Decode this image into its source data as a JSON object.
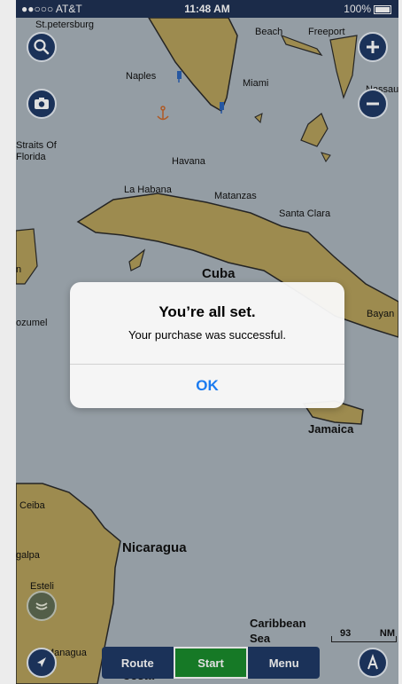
{
  "status_bar": {
    "carrier": "●●○○○ AT&T",
    "time": "11:48 AM",
    "battery": "100%"
  },
  "map": {
    "labels": {
      "st_petersburg": "St.petersburg",
      "beach": "Beach",
      "freeport": "Freeport",
      "naples": "Naples",
      "miami": "Miami",
      "nassau": "Nassau",
      "straits": "Straits Of",
      "florida": "Florida",
      "havana": "Havana",
      "la_habana": "La Habana",
      "matanzas": "Matanzas",
      "santa_clara": "Santa Clara",
      "cuba": "Cuba",
      "cozumel": "ozumel",
      "bayan": "Bayan",
      "an": "n",
      "jamaica": "Jamaica",
      "ceiba": "Ceiba",
      "nicaragua": "Nicaragua",
      "galpa": "galpa",
      "esteli": "Esteli",
      "managua": "Managua",
      "caribbean": "Caribbean",
      "sea": "Sea",
      "costa": "Costa"
    }
  },
  "scale": {
    "value": "93",
    "unit": "NM"
  },
  "alert": {
    "title": "You’re all set.",
    "message": "Your purchase was successful.",
    "ok_label": "OK"
  },
  "bottom_bar": {
    "route": "Route",
    "start": "Start",
    "menu": "Menu"
  },
  "colors": {
    "water": "#a9b3bb",
    "land": "#b39f5a",
    "button_blue": "#1f3a66",
    "start_green": "#1a8a2c",
    "ok_blue": "#1b7bf0"
  },
  "icons": {
    "search": "search-icon",
    "camera": "camera-icon",
    "zoom_in": "plus-icon",
    "zoom_out": "minus-icon",
    "location": "location-arrow-icon",
    "sonar": "sonar-icon",
    "autopilot": "autopilot-a-icon",
    "anchor": "anchor-icon",
    "pin": "map-pin-icon"
  }
}
